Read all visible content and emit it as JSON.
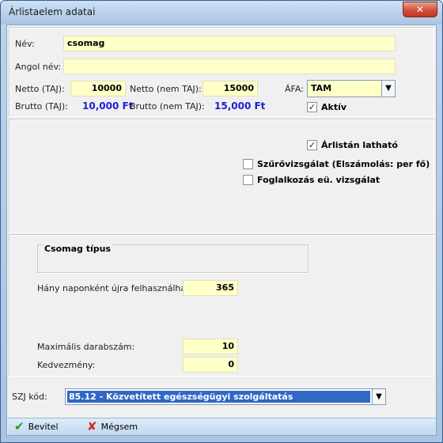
{
  "window": {
    "title": "Árlistaelem adatai",
    "close_symbol": "✕"
  },
  "main": {
    "nev_label": "Név:",
    "nev_value": "csomag",
    "angol_nev_label": "Angol név:",
    "angol_nev_value": "",
    "netto_taj_label": "Netto (TAJ):",
    "netto_taj_value": "10000",
    "netto_nemtaj_label": "Netto (nem TAJ):",
    "netto_nemtaj_value": "15000",
    "afa_label": "ÁFA:",
    "afa_value": "TAM",
    "brutto_taj_label": "Brutto (TAJ):",
    "brutto_taj_value": "10,000 Ft",
    "brutto_nemtaj_label": "Brutto (nem TAJ):",
    "brutto_nemtaj_value": "15,000 Ft",
    "aktiv_label": "Aktív",
    "aktiv_checked": true
  },
  "options": {
    "arlistan_label": "Árlistán latható",
    "arlistan_checked": true,
    "szurovizsgalat_label": "Szűrővizsgálat (Elszámolás: per fő)",
    "szurovizsgalat_checked": false,
    "foglalkozas_label": "Foglalkozás eü. vizsgálat",
    "foglalkozas_checked": false
  },
  "package": {
    "csomag_tipus_label": "Csomag típus",
    "hany_naponkent_label": "Hány naponként újra felhasználható:",
    "hany_naponkent_value": "365",
    "max_darab_label": "Maximális darabszám:",
    "max_darab_value": "10",
    "kedvezmeny_label": "Kedvezmény:",
    "kedvezmeny_value": "0"
  },
  "szj": {
    "label": "SZJ kód:",
    "value": "85.12 - Közvetített egészségügyi szolgáltatás"
  },
  "actions": {
    "bevitel_label": "Bevitel",
    "megsem_label": "Mégsem"
  },
  "icons": {
    "check": "check-icon",
    "cross": "cross-icon",
    "dropdown": "chevron-down-icon"
  },
  "colors": {
    "field_bg": "#ffffc8",
    "money": "#1d1dd6",
    "selection": "#3167c5"
  }
}
